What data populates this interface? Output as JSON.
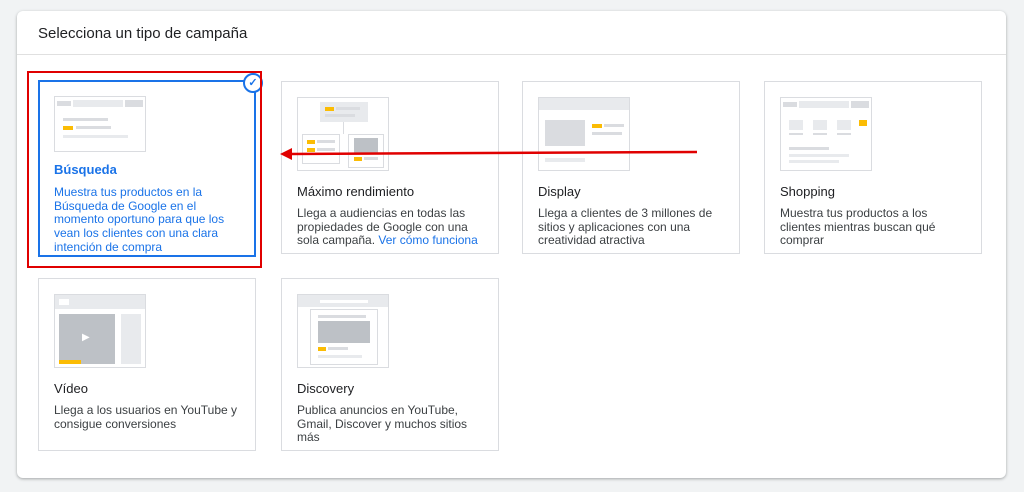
{
  "panel": {
    "title": "Selecciona un tipo de campaña"
  },
  "cards": [
    {
      "title": "Búsqueda",
      "desc": "Muestra tus productos en la Búsqueda de Google en el momento oportuno para que los vean los clientes con una clara intención de compra",
      "selected": true
    },
    {
      "title": "Máximo rendimiento",
      "desc": "Llega a audiencias en todas las propiedades de Google con una sola campaña.",
      "link": "Ver cómo funciona"
    },
    {
      "title": "Display",
      "desc": "Llega a clientes de 3 millones de sitios y aplicaciones con una creatividad atractiva"
    },
    {
      "title": "Shopping",
      "desc": "Muestra tus productos a los clientes mientras buscan qué comprar"
    },
    {
      "title": "Vídeo",
      "desc": "Llega a los usuarios en YouTube y consigue conversiones"
    },
    {
      "title": "Discovery",
      "desc": "Publica anuncios en YouTube, Gmail, Discover y muchos sitios más"
    }
  ],
  "icons": {
    "check": "check-circle-icon",
    "play": "play-icon"
  },
  "colors": {
    "accent": "#1a73e8",
    "annotation": "#e00000",
    "yellow": "#fbbc04"
  }
}
